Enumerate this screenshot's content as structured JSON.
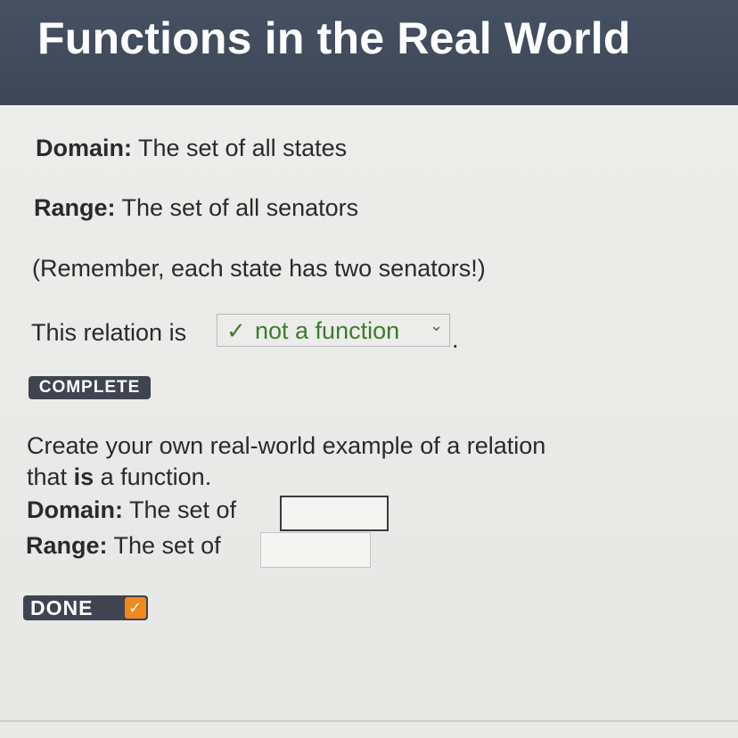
{
  "header": {
    "title": "Functions in the Real World"
  },
  "relation": {
    "domain_label": "Domain:",
    "domain_text": "The set of all states",
    "range_label": "Range:",
    "range_text": "The set of all senators",
    "note": "(Remember, each state has two senators!)",
    "prompt_text": "This relation is",
    "select": {
      "check": "✓",
      "value": "not a function",
      "chevron": "⌄"
    },
    "period": ".",
    "status_badge": "COMPLETE"
  },
  "create": {
    "line1": "Create your own real-world example of a relation",
    "line2_pre": "that",
    "line2_emph": "is",
    "line2_post": "a function.",
    "domain_label": "Domain:",
    "domain_text": "The set of",
    "domain_value": "",
    "range_label": "Range:",
    "range_text": "The set of",
    "range_value": "",
    "done_label": "DONE",
    "done_check": "✓"
  },
  "colors": {
    "header_bg": "#3c4657",
    "correct_green": "#3f7a2e",
    "badge_bg": "#3f4450",
    "done_accent": "#f08a1e"
  }
}
